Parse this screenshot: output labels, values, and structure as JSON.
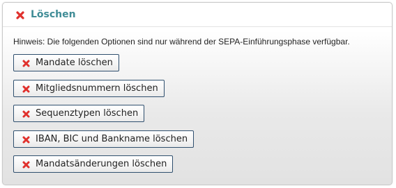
{
  "panel": {
    "title": "Löschen",
    "icon": "delete-x-icon",
    "notice": "Hinweis: Die folgenden Optionen sind nur während der SEPA-Einführungsphase verfügbar."
  },
  "buttons": [
    {
      "label": "Mandate löschen",
      "icon": "delete-x-icon"
    },
    {
      "label": "Mitgliedsnummern löschen",
      "icon": "delete-x-icon"
    },
    {
      "label": "Sequenztypen löschen",
      "icon": "delete-x-icon"
    },
    {
      "label": "IBAN, BIC und Bankname löschen",
      "icon": "delete-x-icon"
    },
    {
      "label": "Mandatsänderungen löschen",
      "icon": "delete-x-icon"
    }
  ],
  "colors": {
    "title": "#3f8c96",
    "delete_icon": "#e0312d",
    "button_border": "#2f4f6e"
  }
}
